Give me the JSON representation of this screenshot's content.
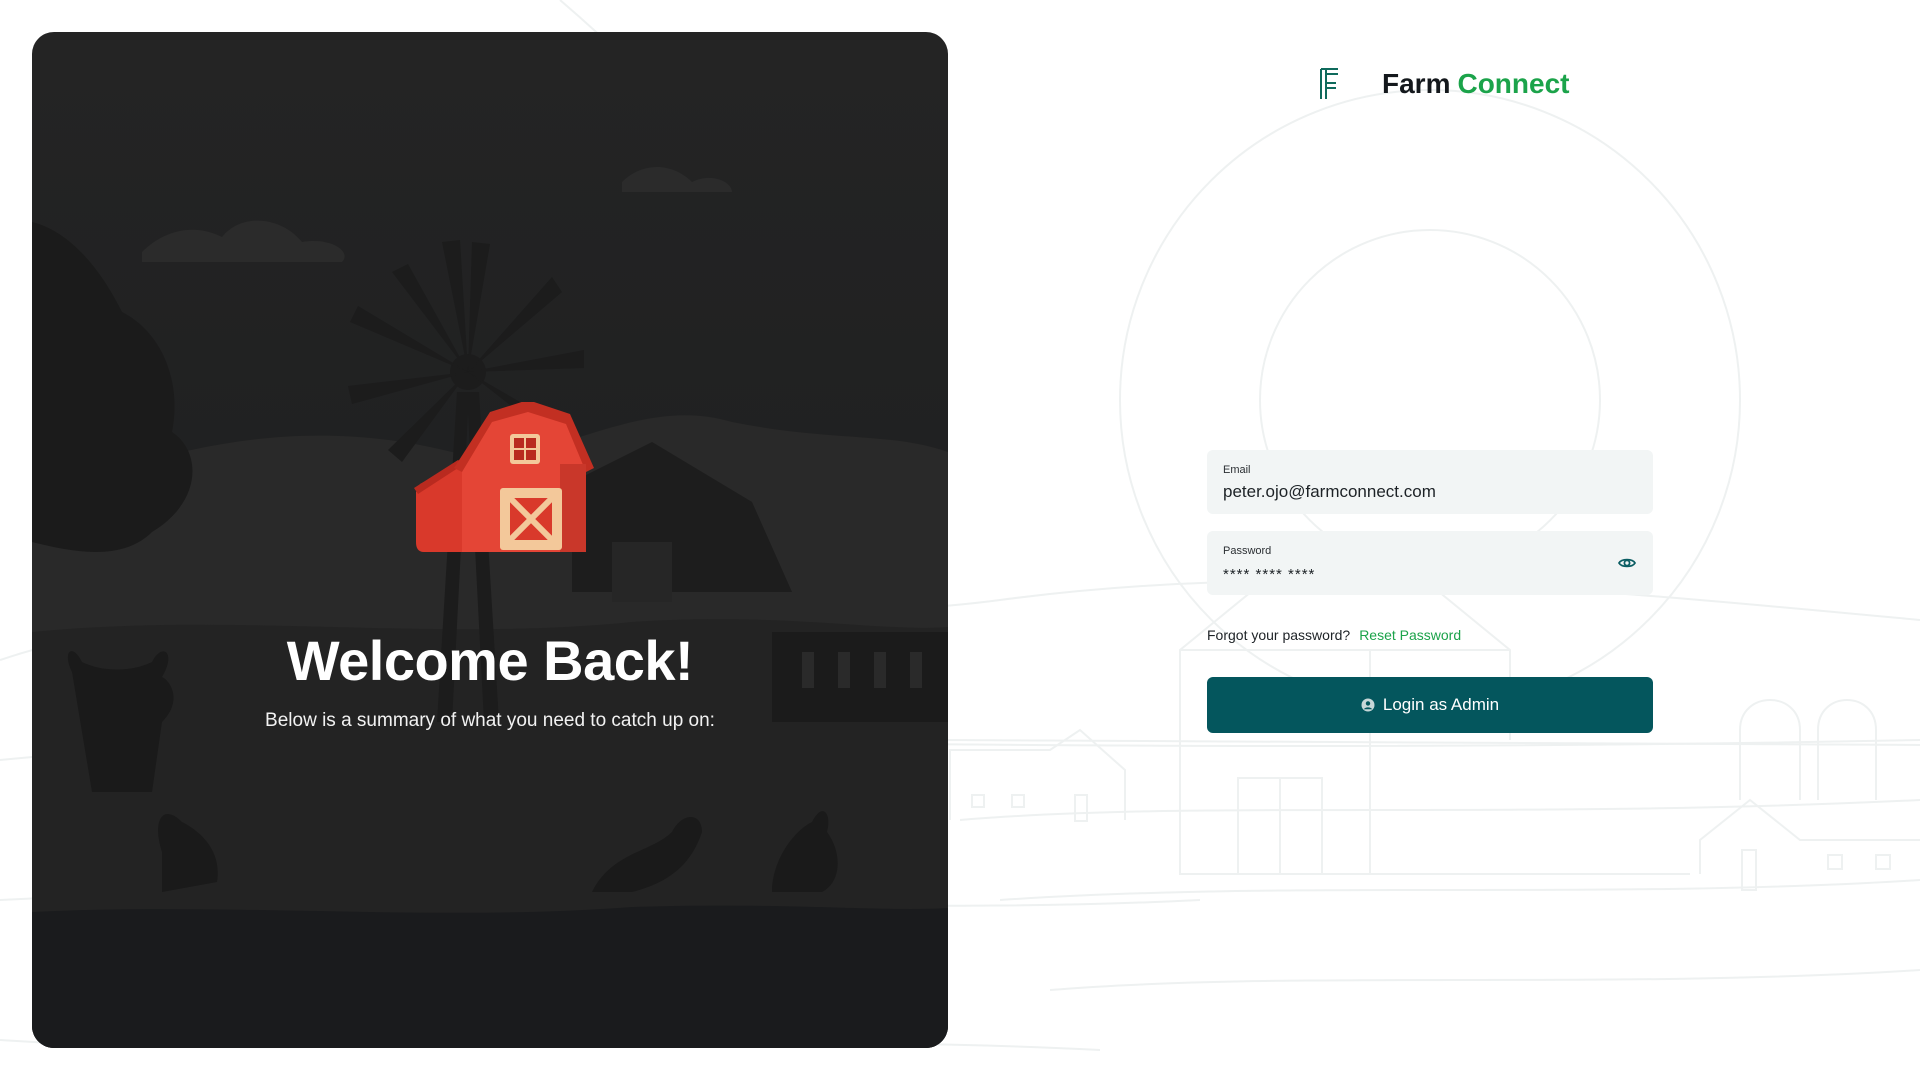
{
  "hero": {
    "title": "Welcome Back!",
    "subtitle": "Below is a summary of what you need to catch up on:"
  },
  "brand": {
    "name_primary": "Farm",
    "name_accent": "Connect",
    "logo_icon": "farm-connect-logo-icon"
  },
  "login_form": {
    "email": {
      "label": "Email",
      "value": "peter.ojo@farmconnect.com"
    },
    "password": {
      "label": "Password",
      "value": "**** **** ****",
      "toggle_icon": "eye-icon"
    },
    "forgot_text": "Forgot your password?",
    "reset_link": "Reset Password",
    "submit_label": "Login as Admin",
    "submit_icon": "user-icon"
  },
  "colors": {
    "brand_green": "#1ba34a",
    "button_teal": "#04565d",
    "field_bg": "#f2f5f5",
    "hero_bg": "#222324"
  }
}
